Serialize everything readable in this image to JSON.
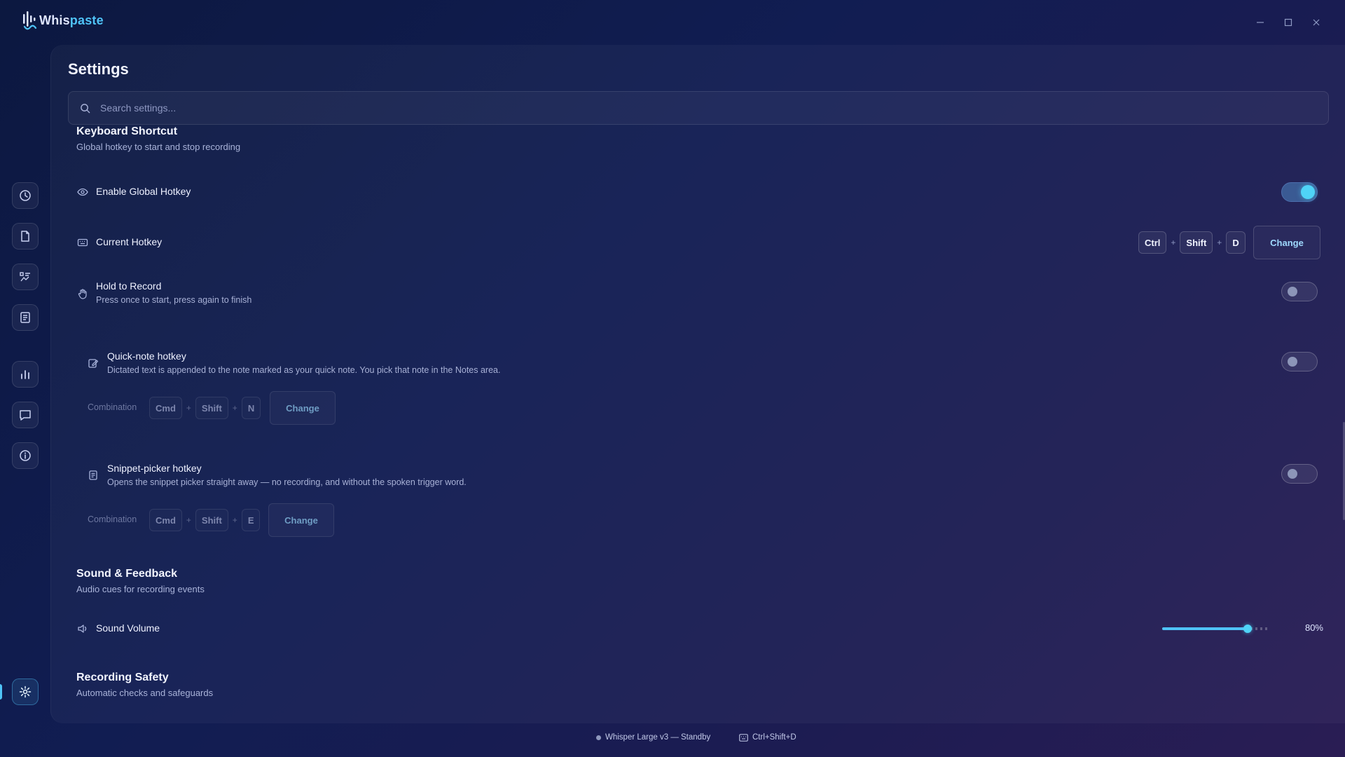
{
  "app": {
    "name_prefix": "Whis",
    "name_suffix": "paste"
  },
  "page": {
    "title": "Settings"
  },
  "search": {
    "placeholder": "Search settings..."
  },
  "sections": {
    "keyboard": {
      "title": "Keyboard Shortcut",
      "subtitle": "Global hotkey to start and stop recording",
      "enable_hotkey": {
        "label": "Enable Global Hotkey",
        "enabled": true
      },
      "current_hotkey": {
        "label": "Current Hotkey",
        "keys": [
          "Ctrl",
          "Shift",
          "D"
        ],
        "change_label": "Change"
      },
      "hold_to_record": {
        "label": "Hold to Record",
        "description": "Press once to start, press again to finish",
        "enabled": false
      },
      "quick_note": {
        "label": "Quick-note hotkey",
        "description": "Dictated text is appended to the note marked as your quick note. You pick that note in the Notes area.",
        "enabled": false,
        "combination_label": "Combination",
        "keys": [
          "Cmd",
          "Shift",
          "N"
        ],
        "change_label": "Change"
      },
      "snippet_picker": {
        "label": "Snippet-picker hotkey",
        "description": "Opens the snippet picker straight away — no recording, and without the spoken trigger word.",
        "enabled": false,
        "combination_label": "Combination",
        "keys": [
          "Cmd",
          "Shift",
          "E"
        ],
        "change_label": "Change"
      }
    },
    "sound": {
      "title": "Sound & Feedback",
      "subtitle": "Audio cues for recording events",
      "volume": {
        "label": "Sound Volume",
        "value_percent": 80,
        "value_text": "80%"
      }
    },
    "safety": {
      "title": "Recording Safety",
      "subtitle": "Automatic checks and safeguards"
    }
  },
  "sidebar": {
    "items": [
      {
        "icon": "history-icon"
      },
      {
        "icon": "document-icon"
      },
      {
        "icon": "snippets-icon"
      },
      {
        "icon": "notes-icon"
      },
      {
        "icon": "stats-icon"
      },
      {
        "icon": "feedback-icon"
      },
      {
        "icon": "info-icon"
      },
      {
        "icon": "gear-icon",
        "active": true
      }
    ]
  },
  "status_bar": {
    "model": "Whisper Large v3 — Standby",
    "hotkey": "Ctrl+Shift+D"
  },
  "colors": {
    "accent": "#4fc3f7",
    "background": "#111d52"
  }
}
